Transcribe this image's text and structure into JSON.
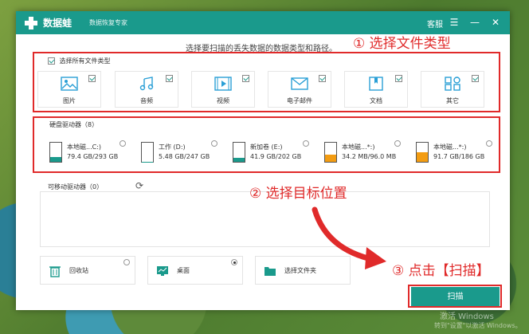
{
  "colors": {
    "accent": "#1a9a8c",
    "annotation": "#e02a2a",
    "drive_system": "#1a9a8c",
    "drive_other": "#f39c12"
  },
  "titlebar": {
    "app_name": "数据蛙",
    "subtitle": "数据恢复专家",
    "service": "客服",
    "icons": [
      "menu-icon",
      "minimize-icon",
      "close-icon"
    ]
  },
  "hint": "选择要扫描的丢失数据的数据类型和路径。",
  "annotations": {
    "step1": "① 选择文件类型",
    "step2": "② 选择目标位置",
    "step3": "③ 点击【扫描】"
  },
  "file_types": {
    "select_all_label": "选择所有文件类型",
    "select_all_checked": true,
    "items": [
      {
        "label": "图片",
        "icon": "image-icon",
        "checked": true
      },
      {
        "label": "音频",
        "icon": "audio-icon",
        "checked": true
      },
      {
        "label": "视频",
        "icon": "video-icon",
        "checked": true
      },
      {
        "label": "电子邮件",
        "icon": "email-icon",
        "checked": true
      },
      {
        "label": "文档",
        "icon": "document-icon",
        "checked": true
      },
      {
        "label": "其它",
        "icon": "other-icon",
        "checked": true
      }
    ]
  },
  "drives": {
    "title": "硬盘驱动器（8）",
    "items": [
      {
        "name": "本地磁...C:)",
        "size": "79.4 GB/293 GB",
        "used_fraction": 0.27,
        "color": "#1a9a8c"
      },
      {
        "name": "工作 (D:)",
        "size": "5.48 GB/247 GB",
        "used_fraction": 0.02,
        "color": "#1a9a8c"
      },
      {
        "name": "新加卷 (E:)",
        "size": "41.9 GB/202 GB",
        "used_fraction": 0.21,
        "color": "#1a9a8c"
      },
      {
        "name": "本地磁...*:)",
        "size": "34.2 MB/96.0 MB",
        "used_fraction": 0.36,
        "color": "#f39c12"
      },
      {
        "name": "本地磁...*:)",
        "size": "91.7 GB/186 GB",
        "used_fraction": 0.49,
        "color": "#f39c12"
      }
    ]
  },
  "mobile": {
    "title": "可移动驱动器（0）",
    "refresh_icon": "refresh-icon"
  },
  "locations": [
    {
      "label": "回收站",
      "icon": "recycle-bin-icon",
      "selected": false
    },
    {
      "label": "桌面",
      "icon": "desktop-icon",
      "selected": true
    },
    {
      "label": "选择文件夹",
      "icon": "folder-icon",
      "selected": false
    }
  ],
  "scan_button": "扫描",
  "watermark": {
    "line1": "激活 Windows",
    "line2": "转到\"设置\"以激活 Windows。"
  }
}
